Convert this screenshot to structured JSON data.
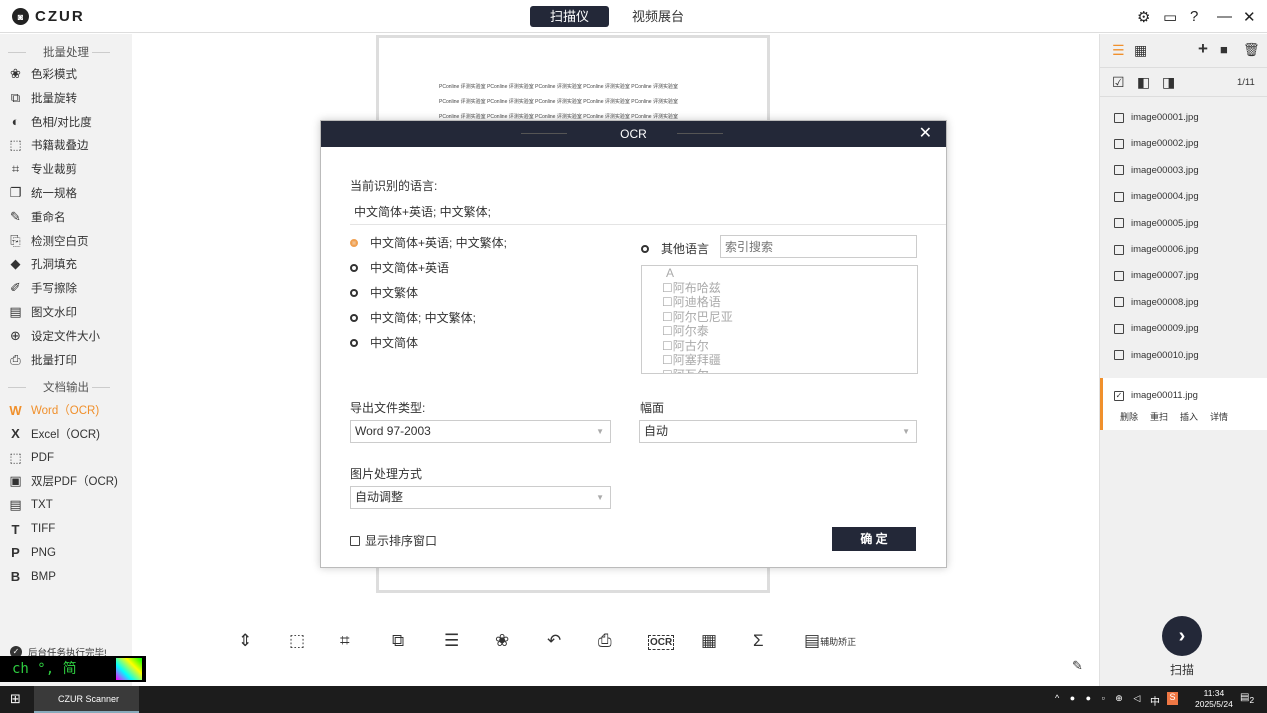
{
  "app": {
    "logo": "CZUR",
    "tabs": [
      "扫描仪",
      "视频展台"
    ]
  },
  "sidebar": {
    "section1": "批量处理",
    "items1": [
      {
        "icon": "color-mode-icon",
        "g": "❀",
        "label": "色彩模式"
      },
      {
        "icon": "rotate-icon",
        "g": "⧉",
        "label": "批量旋转"
      },
      {
        "icon": "contrast-icon",
        "g": "◐",
        "label": "色相/对比度"
      },
      {
        "icon": "book-crop-icon",
        "g": "⬚",
        "label": "书籍裁叠边"
      },
      {
        "icon": "crop-icon",
        "g": "⌗",
        "label": "专业裁剪"
      },
      {
        "icon": "uniform-icon",
        "g": "❐",
        "label": "统一规格"
      },
      {
        "icon": "rename-icon",
        "g": "✎",
        "label": "重命名"
      },
      {
        "icon": "blank-page-icon",
        "g": "⎘",
        "label": "检测空白页"
      },
      {
        "icon": "fill-icon",
        "g": "◆",
        "label": "孔洞填充"
      },
      {
        "icon": "eraser-icon",
        "g": "✐",
        "label": "手写擦除"
      },
      {
        "icon": "watermark-icon",
        "g": "▤",
        "label": "图文水印"
      },
      {
        "icon": "file-size-icon",
        "g": "⊕",
        "label": "设定文件大小"
      },
      {
        "icon": "print-icon",
        "g": "⎙",
        "label": "批量打印"
      }
    ],
    "section2": "文档输出",
    "items2": [
      {
        "icon": "word-icon",
        "g": "W",
        "label": "Word（OCR)"
      },
      {
        "icon": "excel-icon",
        "g": "X",
        "label": "Excel（OCR)"
      },
      {
        "icon": "pdf-icon",
        "g": "⬚",
        "label": "PDF"
      },
      {
        "icon": "dual-pdf-icon",
        "g": "▣",
        "label": "双层PDF（OCR)"
      },
      {
        "icon": "txt-icon",
        "g": "▤",
        "label": "TXT"
      },
      {
        "icon": "tiff-icon",
        "g": "T",
        "label": "TIFF"
      },
      {
        "icon": "png-icon",
        "g": "P",
        "label": "PNG"
      },
      {
        "icon": "bmp-icon",
        "g": "B",
        "label": "BMP"
      }
    ],
    "status": "后台任务执行完毕!"
  },
  "preview": {
    "lines": [
      "PConline 评测实验室 PConline 评测实验室 PConline 评测实验室 PConline 评测实验室 PConline 评测实验室",
      "PConline 评测实验室 PConline 评测实验室 PConline 评测实验室 PConline 评测实验室 PConline 评测实验室",
      "PConline 评测实验室 PConline 评测实验室 PConline 评测实验室 PConline 评测实验室 PConline 评测实验室"
    ]
  },
  "modal": {
    "title": "OCR",
    "current_label": "当前识别的语言:",
    "current_value": "中文简体+英语; 中文繁体;",
    "options": [
      "中文简体+英语; 中文繁体;",
      "中文简体+英语",
      "中文繁体",
      "中文简体; 中文繁体;",
      "中文简体"
    ],
    "other_label": "其他语言",
    "search_placeholder": "索引搜索",
    "lang_group": "A",
    "langs": [
      "阿布哈兹",
      "阿迪格语",
      "阿尔巴尼亚",
      "阿尔泰",
      "阿古尔",
      "阿塞拜疆",
      "阿瓦尔"
    ],
    "export_label": "导出文件类型:",
    "export_value": "Word 97-2003",
    "layout_label": "幅面",
    "layout_value": "自动",
    "image_label": "图片处理方式",
    "image_value": "自动调整",
    "show_sort": "显示排序窗口",
    "ok": "确 定"
  },
  "right": {
    "counter": "1/11",
    "files": [
      "image00001.jpg",
      "image00002.jpg",
      "image00003.jpg",
      "image00004.jpg",
      "image00005.jpg",
      "image00006.jpg",
      "image00007.jpg",
      "image00008.jpg",
      "image00009.jpg",
      "image00010.jpg"
    ],
    "selected": "image00011.jpg",
    "actions": [
      "删除",
      "重扫",
      "插入",
      "详情"
    ],
    "scan": "扫描"
  },
  "toolbar": {
    "assist": "辅助矫正",
    "ocr": "OCR"
  },
  "ime": {
    "text": "ch °, 简"
  },
  "taskbar": {
    "app": "CZUR Scanner",
    "time": "11:34",
    "date": "2025/5/24",
    "ime": "中",
    "notif": "2"
  },
  "colors": {
    "accent": "#f0902c",
    "dark": "#232838"
  }
}
